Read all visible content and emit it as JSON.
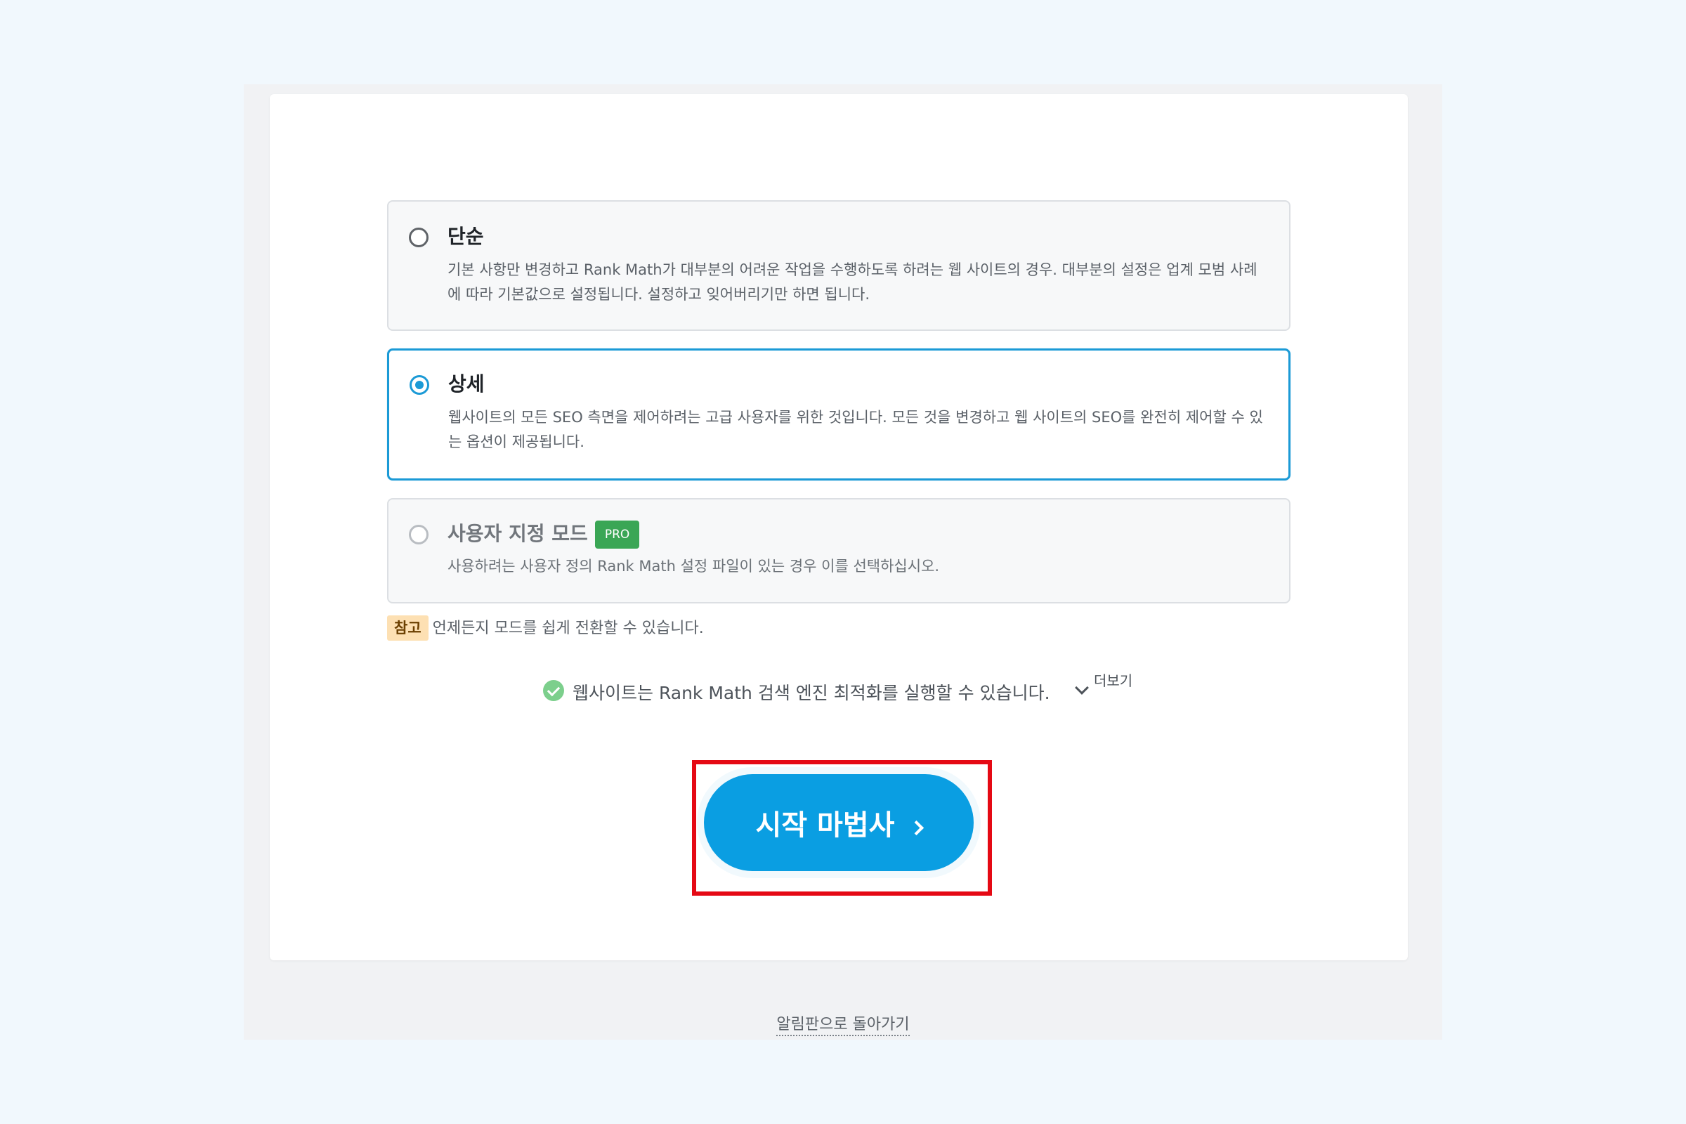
{
  "options": [
    {
      "title": "단순",
      "description": "기본 사항만 변경하고 Rank Math가 대부분의 어려운 작업을 수행하도록 하려는 웹 사이트의 경우. 대부분의 설정은 업계 모범 사례에 따라 기본값으로 설정됩니다. 설정하고 잊어버리기만 하면 됩니다.",
      "selected": false
    },
    {
      "title": "상세",
      "description": "웹사이트의 모든 SEO 측면을 제어하려는 고급 사용자를 위한 것입니다. 모든 것을 변경하고 웹 사이트의 SEO를 완전히 제어할 수 있는 옵션이 제공됩니다.",
      "selected": true
    },
    {
      "title": "사용자 지정 모드",
      "badge": "PRO",
      "description": "사용하려는 사용자 정의 Rank Math 설정 파일이 있는 경우 이를 선택하십시오.",
      "selected": false
    }
  ],
  "note": {
    "badge": "참고",
    "text": "언제든지 모드를 쉽게 전환할 수 있습니다."
  },
  "status": {
    "text": "웹사이트는 Rank Math 검색 엔진 최적화를 실행할 수 있습니다.",
    "more_label": "더보기",
    "icon": "check-circle-icon"
  },
  "start_button": {
    "label": "시작 마법사",
    "icon": "chevron-right-icon"
  },
  "back_link": {
    "label": "알림판으로 돌아가기"
  },
  "colors": {
    "accent": "#0a9ee2",
    "selected_border": "#1b9ad6",
    "pro_badge": "#3aa655",
    "note_badge": "#fde0b3",
    "highlight": "#e50914",
    "check": "#7ccf8c"
  }
}
